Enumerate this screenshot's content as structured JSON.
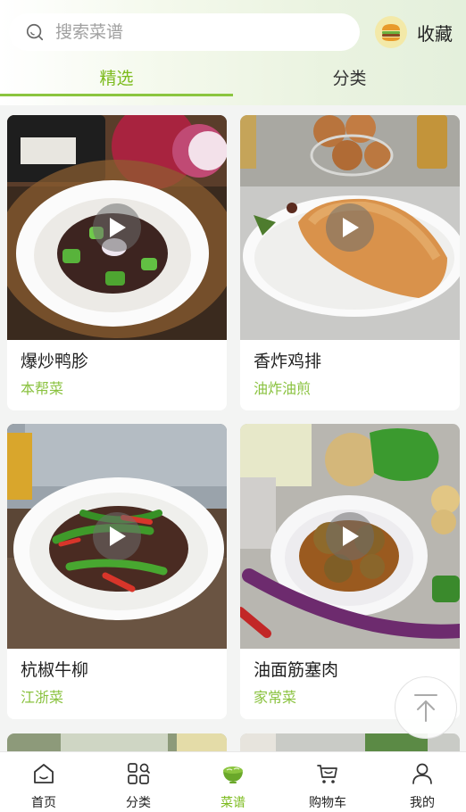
{
  "header": {
    "search": {
      "placeholder": "搜索菜谱",
      "icon": "search-icon"
    },
    "favorites": {
      "label": "收藏",
      "icon": "burger-icon"
    }
  },
  "tabs": [
    {
      "label": "精选",
      "active": true
    },
    {
      "label": "分类",
      "active": false
    }
  ],
  "cards": [
    {
      "title": "爆炒鸭胗",
      "tag": "本帮菜",
      "has_video": true
    },
    {
      "title": "香炸鸡排",
      "tag": "油炸油煎",
      "has_video": true
    },
    {
      "title": "杭椒牛柳",
      "tag": "江浙菜",
      "has_video": true
    },
    {
      "title": "油面筋塞肉",
      "tag": "家常菜",
      "has_video": true
    }
  ],
  "back_to_top": {
    "icon": "arrow-up-icon"
  },
  "bottom_nav": [
    {
      "label": "首页",
      "icon": "home-icon",
      "active": false
    },
    {
      "label": "分类",
      "icon": "category-icon",
      "active": false
    },
    {
      "label": "菜谱",
      "icon": "recipe-bowl-icon",
      "active": true
    },
    {
      "label": "购物车",
      "icon": "cart-icon",
      "active": false
    },
    {
      "label": "我的",
      "icon": "user-icon",
      "active": false
    }
  ],
  "colors": {
    "accent": "#8bc53f",
    "tag": "#8ac23f",
    "background": "#f3f4f3"
  }
}
